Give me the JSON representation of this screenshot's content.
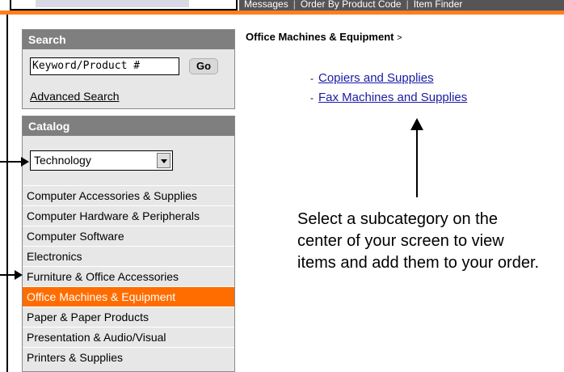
{
  "top_nav": {
    "tabs": [
      "Messages",
      "Order By Product Code",
      "Item Finder"
    ]
  },
  "search": {
    "header": "Search",
    "input_value": "Keyword/Product #",
    "go_label": "Go",
    "advanced_link": "Advanced Search"
  },
  "catalog": {
    "header": "Catalog",
    "selected": "Technology",
    "items": [
      "Computer Accessories & Supplies",
      "Computer Hardware & Peripherals",
      "Computer Software",
      "Electronics",
      "Furniture & Office Accessories",
      "Office Machines & Equipment",
      "Paper & Paper Products",
      "Presentation & Audio/Visual",
      "Printers & Supplies"
    ],
    "active_item": "Office Machines & Equipment"
  },
  "main": {
    "breadcrumb": "Office Machines & Equipment",
    "breadcrumb_sep": ">",
    "subcategories": [
      "Copiers and Supplies",
      "Fax Machines and Supplies"
    ],
    "dash": "-",
    "instructions": "Select a subcategory on the center of your screen to view items and add them to your order."
  },
  "colors": {
    "accent_orange": "#ff6d00",
    "header_gray": "#7f7f7f",
    "panel_bg": "#e7e7e7",
    "link_blue": "#1a1aa6"
  }
}
